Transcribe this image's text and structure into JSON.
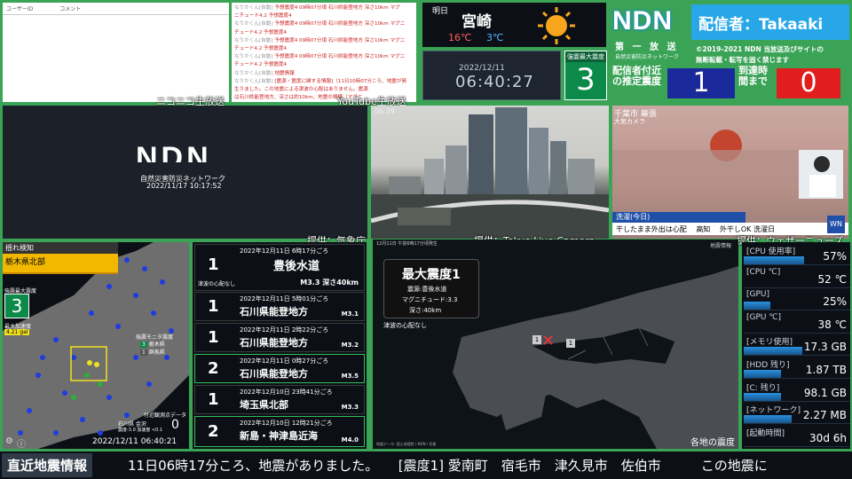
{
  "comments_panel": {
    "col_user": "ユーザーID",
    "col_comment": "コメント"
  },
  "youtube_chat": {
    "name": "なりかくん[自動]",
    "lines": [
      "予想震度4 09時07分頃 石川県能登地方 深さ10km マグ",
      "ニチュード4.2 予想震度4",
      "予想震度4 09時07分頃 石川県能登地方 深さ10km マグニ",
      "チュード4.2 予想震度4",
      "予想震度4 09時07分頃 石川県能登地方 深さ10km マグニ",
      "チュード4.2 予想震度4",
      "予想震度4 09時07分頃 石川県能登地方 深さ10km マグニ",
      "チュード4.2 予想震度4",
      "地震情報",
      "[震源・震度に関する情報]（11日10時07分ころ、地震が発",
      "生りました。この地震による津波の心配はありません。震源",
      "は石川県能登地方、深さは約10km、地震の規模（マグニ",
      "チュード）は約3.5。最大震度3 ...",
      "[石川県]震度1：輪島市",
      "地震情報 終了"
    ]
  },
  "captions": {
    "niconico": "ニコニコ生放送",
    "youtube": "YouTube生放送",
    "kishocho": "提供：気象庁",
    "tokyo_live": "提供：Tokyo Live Camera",
    "weathernews": "提供：ウェザーニューズ"
  },
  "weather": {
    "label": "明日",
    "city": "宮崎",
    "high": "16℃",
    "low": "3℃",
    "icon": "sun-icon"
  },
  "clock": {
    "date": "2022/12/11",
    "time": "06:40:27"
  },
  "max_intensity": {
    "title": "強震最大震度",
    "value": "3"
  },
  "ndn": {
    "logo": "NDN",
    "sub1": "第 一 放 送",
    "sub2": "自然災害防災ネットワーク",
    "host": "配信者：Takaaki",
    "copyright1": "©2019-2021 NDN 当放送及びサイトの",
    "copyright2": "無断転載・転写を固く禁じます",
    "est_label": "配信者付近の推定震度",
    "est_value": "1",
    "arr_label": "到達時間まで",
    "arr_value": "0"
  },
  "ndn_video": {
    "logo": "NDN",
    "subtitle": "自然災害防災ネットワーク",
    "timestamp": "2022/11/17 10:17:52"
  },
  "city_cam": {
    "time": "06 39"
  },
  "weather_cam": {
    "place": "千葉市 幕張",
    "sub": "大気カメラ",
    "laundry": "洗濯(今日)",
    "l1": "干したまま外出は心配",
    "l2": "高知",
    "l3": "外干しOK 洗濯日",
    "brand": "WN"
  },
  "kyoshin": {
    "title": "揺れ検知",
    "region": "栃木県北部",
    "max_label": "強震最大震度",
    "max_value": "3",
    "acc_label": "最大加速度",
    "acc_value": "4.21 gal",
    "legend_title": "強震モニタ震度",
    "legend": [
      {
        "v": "3",
        "n": "栃木県"
      },
      {
        "v": "1",
        "n": "群馬県"
      }
    ],
    "near_label": "付近観測点データ",
    "near_loc": "石川県 金沢",
    "near_data": "震度-3.0  加速度 <0.1",
    "near_value": "0",
    "stamp": "2022/12/11 06:40:21"
  },
  "eq_list": {
    "top": {
      "intensity": "1",
      "time": "2022年12月11日 6時17分ごろ",
      "area": "豊後水道",
      "tsunami": "津波の心配なし",
      "mag": "M3.3 深さ40km"
    },
    "rows": [
      {
        "intensity": "1",
        "time": "2022年12月11日 5時01分ごろ",
        "area": "石川県能登地方",
        "mag": "M3.1"
      },
      {
        "intensity": "1",
        "time": "2022年12月11日 2時22分ごろ",
        "area": "石川県能登地方",
        "mag": "M3.2"
      },
      {
        "intensity": "2",
        "time": "2022年12月11日 0時27分ごろ",
        "area": "石川県能登地方",
        "mag": "M3.5"
      },
      {
        "intensity": "1",
        "time": "2022年12月10日 23時41分ごろ",
        "area": "埼玉県北部",
        "mag": "M3.3"
      },
      {
        "intensity": "2",
        "time": "2022年12月10日 12時21分ごろ",
        "area": "新島・神津島近海",
        "mag": "M4.0"
      }
    ]
  },
  "eq_map": {
    "header": "12月11日 午前6時17分頃発生",
    "header_right": "地震情報",
    "title": "最大震度1",
    "epicenter": "震源:豊後水道",
    "magnitude": "マグニチュード:3.3",
    "depth": "深さ:40km",
    "tsunami": "津波の心配なし",
    "footer": "各地の震度",
    "credit": "地図データ: 国土地理院 / NDN / 気象"
  },
  "pc_stats": [
    {
      "label": "[CPU 使用率]",
      "value": "57%",
      "fill": 0.57
    },
    {
      "label": "[CPU ℃]",
      "value": "52 ℃",
      "fill": 0
    },
    {
      "label": "[GPU]",
      "value": "25%",
      "fill": 0.25
    },
    {
      "label": "[GPU ℃]",
      "value": "38 ℃",
      "fill": 0
    },
    {
      "label": "[メモリ使用]",
      "value": "17.3 GB",
      "fill": 0.55
    },
    {
      "label": "[HDD 残り]",
      "value": "1.87 TB",
      "fill": 0.35
    },
    {
      "label": "[C: 残り]",
      "value": "98.1 GB",
      "fill": 0.35
    },
    {
      "label": "[ネットワーク]",
      "value": "2.27 MB",
      "fill": 0.45
    },
    {
      "label": "[起動時間]",
      "value": "30d 6h",
      "fill": 0
    }
  ],
  "ticker": {
    "label": "直近地震情報",
    "text": "11日06時17分ころ、地震がありました。　　[震度1] 愛南町　宿毛市　津久見市　佐伯市　　　この地震に"
  }
}
